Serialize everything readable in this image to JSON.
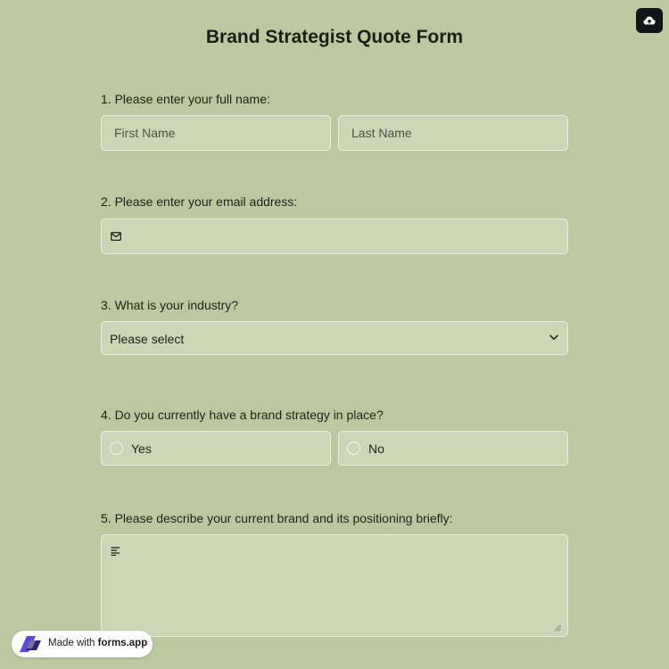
{
  "form": {
    "title": "Brand Strategist Quote Form"
  },
  "questions": {
    "q1": {
      "label": "1.  Please enter your full name:",
      "first_placeholder": "First Name",
      "last_placeholder": "Last Name"
    },
    "q2": {
      "label": "2. Please enter your email address:",
      "icon": "mail-icon"
    },
    "q3": {
      "label": "3. What is your industry?",
      "selected": "Please select",
      "icon": "chevron-down-icon"
    },
    "q4": {
      "label": "4. Do you currently have a brand strategy in place?",
      "options": [
        "Yes",
        "No"
      ]
    },
    "q5": {
      "label": "5. Please describe your current brand and its positioning briefly:",
      "icon": "text-lines-icon"
    }
  },
  "badge": {
    "prefix": "Made with",
    "brand": "forms.app"
  },
  "colors": {
    "background": "#bcc9a0",
    "field_bg": "#cdd7b8",
    "field_border": "#ecf0e3",
    "upload_button": "#111418",
    "logo": "#5b4bd6"
  }
}
